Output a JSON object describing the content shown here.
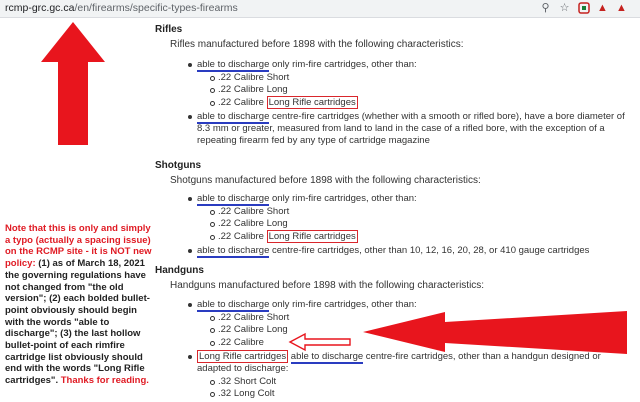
{
  "browser": {
    "url_host": "rcmp-grc.gc.ca",
    "url_path": "/en/firearms/specific-types-firearms",
    "icons": [
      "zoom-icon",
      "star-icon",
      "extension-icon",
      "pdf-icon",
      "pdf-icon"
    ]
  },
  "rifles": {
    "heading": "Rifles",
    "intro": "Rifles manufactured before 1898 with the following characteristics:",
    "b1_lead": "able to discharge",
    "b1_rest": " only rim-fire cartridges, other than:",
    "sub1": ".22 Calibre Short",
    "sub2": ".22 Calibre Long",
    "sub3_a": ".22 Calibre ",
    "sub3_b": "Long Rifle cartridges",
    "b2_lead": "able to discharge",
    "b2_rest": " centre-fire cartridges (whether with a smooth or rifled bore), have a bore diameter of 8.3 mm or greater, measured from land to land in the case of a rifled bore, with the exception of a repeating firearm fed by any type of cartridge magazine"
  },
  "shotguns": {
    "heading": "Shotguns",
    "intro": "Shotguns manufactured before 1898 with the following characteristics:",
    "b1_lead": "able to discharge",
    "b1_rest": " only rim-fire cartridges, other than:",
    "sub1": ".22 Calibre Short",
    "sub2": ".22 Calibre Long",
    "sub3_a": ".22 Calibre ",
    "sub3_b": "Long Rifle cartridges",
    "b2_lead": "able to discharge",
    "b2_rest": " centre-fire cartridges, other than 10, 12, 16, 20, 28, or 410 gauge cartridges"
  },
  "handguns": {
    "heading": "Handguns",
    "intro": "Handguns manufactured before 1898 with the following characteristics:",
    "b1_lead": "able to discharge",
    "b1_rest": " only rim-fire cartridges, other than:",
    "sub1": ".22 Calibre Short",
    "sub2": ".22 Calibre Long",
    "sub3_a": ".22 Calibre",
    "b2_box": "Long Rifle cartridges",
    "b2_lead": "able to discharge",
    "b2_rest": " centre-fire cartridges, other than a handgun designed or adapted to discharge:",
    "sub4": ".32 Short Colt",
    "sub5": ".32 Long Colt"
  },
  "note": {
    "red_part": "Note that this is only and simply a typo (actually a spacing issue) on the RCMP site - it is NOT new policy:",
    "black_part": " (1) as of March 18, 2021 the governing regulations have not changed from \"the old version\"; (2) each bolded bullet-point obviously should begin with the words \"able to discharge\"; (3) the last hollow bullet-point of each rimfire cartridge list obviously should end with the words \"Long Rifle cartridges\".",
    "thanks": " Thanks for reading."
  },
  "colors": {
    "annotation_red": "#e01b24",
    "annotation_blue": "#2a3cc0"
  }
}
